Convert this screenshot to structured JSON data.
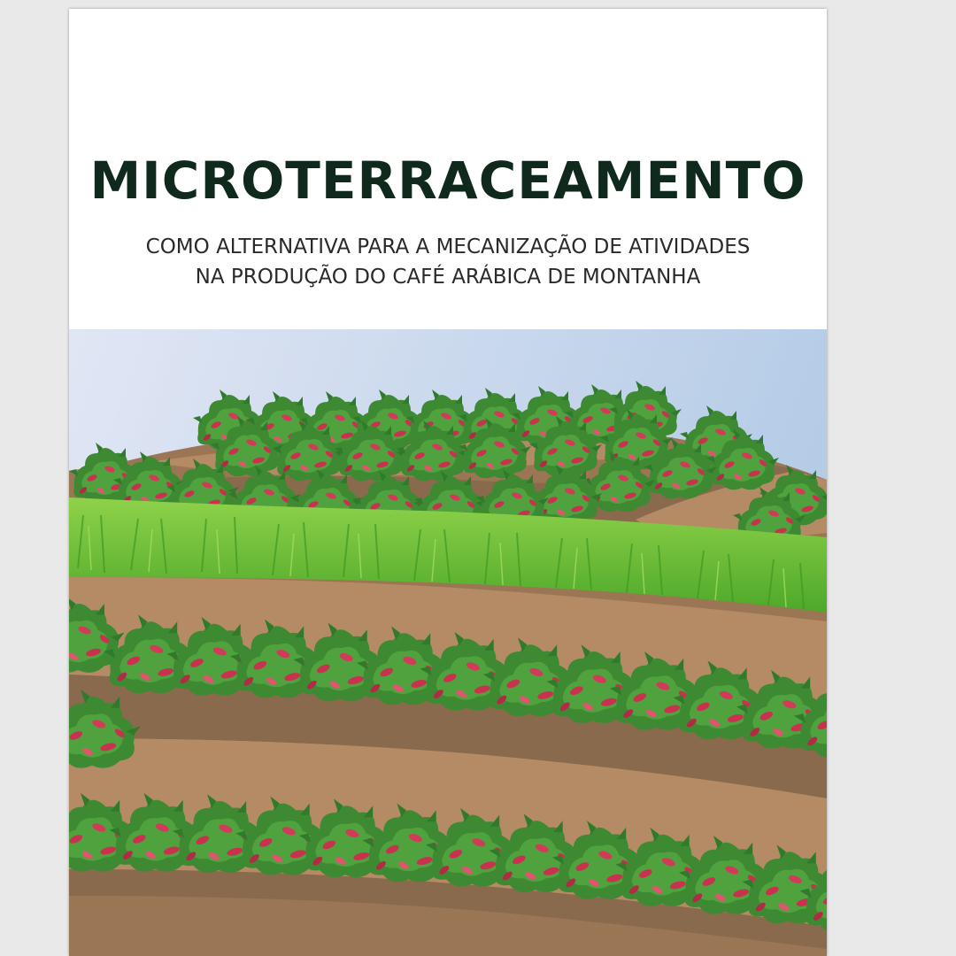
{
  "document": {
    "title": "MICROTERRACEAMENTO",
    "subtitle_line1": "COMO ALTERNATIVA PARA A MECANIZAÇÃO DE ATIVIDADES",
    "subtitle_line2": "NA PRODUÇÃO DO CAFÉ ARÁBICA DE MONTANHA"
  },
  "colors": {
    "title": "#0f2a1c",
    "soil_light": "#b18a63",
    "soil_dark": "#8a6a4c",
    "grass": "#5fb834",
    "leaf": "#3f8c35",
    "berry": "#c8324f",
    "sky_left": "#dfe5f3",
    "sky_right": "#b6cde6"
  }
}
